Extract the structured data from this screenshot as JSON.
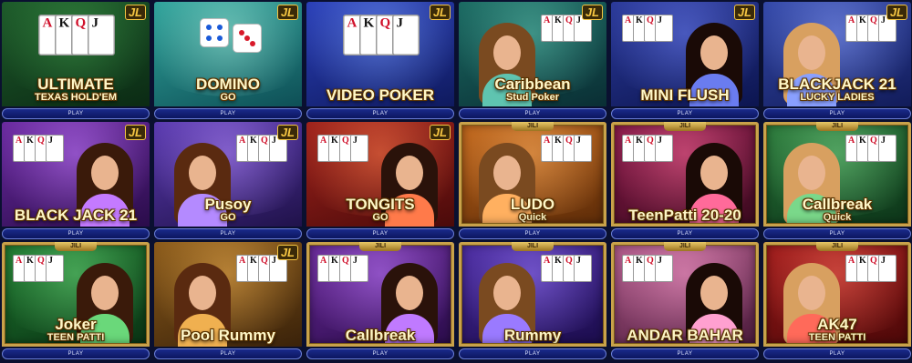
{
  "colors": {
    "page_bg": "#0a1030",
    "play_bar": "#1a2a8a",
    "frame_gold": "#c9a24a",
    "badge_gold": "#f5c542"
  },
  "tiles": [
    {
      "title": "ULTIMATE",
      "subtitle": "TEXAS HOLD'EM",
      "badge": "JL",
      "play": "PLAY",
      "bg1": "#1d5a2a",
      "bg2": "#0b2a14",
      "glow": "#3f9b4a",
      "scene": "cards-only"
    },
    {
      "title": "DOMINO",
      "subtitle": "GO",
      "badge": "JL",
      "play": "PLAY",
      "bg1": "#2fa39b",
      "bg2": "#0e4f56",
      "glow": "#9fe8d8",
      "scene": "dice"
    },
    {
      "title": "VIDEO POKER",
      "subtitle": "",
      "badge": "JL",
      "play": "PLAY",
      "bg1": "#2a3fb8",
      "bg2": "#0f1a5e",
      "glow": "#7aa0ff",
      "scene": "cards-only"
    },
    {
      "title": "Caribbean",
      "subtitle": "Stud Poker",
      "badge": "JL",
      "play": "PLAY",
      "bg1": "#1b6a62",
      "bg2": "#0a2e34",
      "glow": "#5fc4b0",
      "scene": "person"
    },
    {
      "title": "MINI FLUSH",
      "subtitle": "",
      "badge": "JL",
      "play": "PLAY",
      "bg1": "#2b3a9a",
      "bg2": "#0c1550",
      "glow": "#6a7cf0",
      "scene": "person"
    },
    {
      "title": "BLACKJACK 21",
      "subtitle": "LUCKY LADIES",
      "badge": "JL",
      "play": "PLAY",
      "bg1": "#3348a8",
      "bg2": "#121c5a",
      "glow": "#8aa0ff",
      "scene": "person"
    },
    {
      "title": "BLACK JACK 21",
      "subtitle": "",
      "badge": "JL",
      "play": "PLAY",
      "bg1": "#6a2aa0",
      "bg2": "#2a0c4a",
      "glow": "#c47aff",
      "scene": "person"
    },
    {
      "title": "Pusoy",
      "subtitle": "GO",
      "badge": "JL",
      "play": "PLAY",
      "bg1": "#5a3ab0",
      "bg2": "#20124a",
      "glow": "#b48aff",
      "scene": "person"
    },
    {
      "title": "TONGITS",
      "subtitle": "GO",
      "badge": "JL",
      "play": "PLAY",
      "bg1": "#a0231c",
      "bg2": "#4a0a0a",
      "glow": "#ff7a4a",
      "scene": "person"
    },
    {
      "title": "LUDO",
      "subtitle": "Quick",
      "badge": "JILI",
      "play": "PLAY",
      "bg1": "#c2661a",
      "bg2": "#5a2a08",
      "glow": "#ffb060",
      "scene": "person",
      "framed": true
    },
    {
      "title": "TeenPatti 20-20",
      "subtitle": "",
      "badge": "JILI",
      "play": "PLAY",
      "bg1": "#8a1a4a",
      "bg2": "#3a0a1e",
      "glow": "#ff6a9a",
      "scene": "person",
      "framed": true
    },
    {
      "title": "Callbreak",
      "subtitle": "Quick",
      "badge": "JILI",
      "play": "PLAY",
      "bg1": "#2a7a3a",
      "bg2": "#0c3218",
      "glow": "#7ad88a",
      "scene": "person",
      "framed": true
    },
    {
      "title": "Joker",
      "subtitle": "TEEN PATTI",
      "badge": "JILI",
      "play": "PLAY",
      "bg1": "#1f7a30",
      "bg2": "#0a3214",
      "glow": "#6ad87a",
      "scene": "person",
      "framed": true
    },
    {
      "title": "Pool Rummy",
      "subtitle": "",
      "badge": "JL",
      "play": "PLAY",
      "bg1": "#8a5a1a",
      "bg2": "#3a220a",
      "glow": "#f0b050",
      "scene": "person"
    },
    {
      "title": "Callbreak",
      "subtitle": "",
      "badge": "JILI",
      "play": "PLAY",
      "bg1": "#6a2a9a",
      "bg2": "#2a0c4a",
      "glow": "#c07aff",
      "scene": "person",
      "framed": true
    },
    {
      "title": "Rummy",
      "subtitle": "",
      "badge": "JILI",
      "play": "PLAY",
      "bg1": "#4a2aa0",
      "bg2": "#1a0c4a",
      "glow": "#9a7aff",
      "scene": "person",
      "framed": true
    },
    {
      "title": "ANDAR BAHAR",
      "subtitle": "",
      "badge": "JILI",
      "play": "PLAY",
      "bg1": "#b05a8a",
      "bg2": "#4a1a3a",
      "glow": "#ffa0d0",
      "scene": "person",
      "framed": true
    },
    {
      "title": "AK47",
      "subtitle": "TEEN PATTI",
      "badge": "JILI",
      "play": "PLAY",
      "bg1": "#a01a1a",
      "bg2": "#4a0808",
      "glow": "#ff6a5a",
      "scene": "person",
      "framed": true
    }
  ]
}
